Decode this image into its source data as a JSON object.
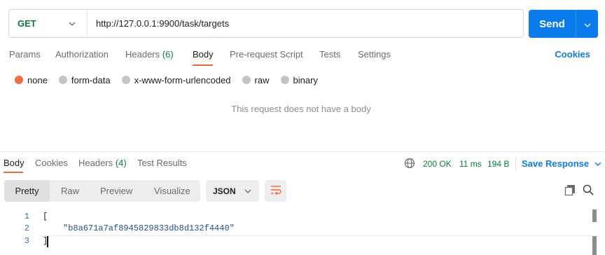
{
  "request": {
    "method": "GET",
    "url": "http://127.0.0.1:9900/task/targets",
    "send_label": "Send"
  },
  "request_tabs": [
    {
      "label": "Params"
    },
    {
      "label": "Authorization"
    },
    {
      "label": "Headers",
      "count": "(6)"
    },
    {
      "label": "Body"
    },
    {
      "label": "Pre-request Script"
    },
    {
      "label": "Tests"
    },
    {
      "label": "Settings"
    }
  ],
  "cookies_link": "Cookies",
  "body_types": {
    "selected": "none",
    "options": [
      "none",
      "form-data",
      "x-www-form-urlencoded",
      "raw",
      "binary"
    ]
  },
  "empty_body_text": "This request does not have a body",
  "response_tabs": [
    {
      "label": "Body"
    },
    {
      "label": "Cookies"
    },
    {
      "label": "Headers",
      "count": "(4)"
    },
    {
      "label": "Test Results"
    }
  ],
  "response_status": {
    "status": "200 OK",
    "time": "11 ms",
    "size": "194 B",
    "save_label": "Save Response"
  },
  "view_modes": [
    "Pretty",
    "Raw",
    "Preview",
    "Visualize"
  ],
  "format": "JSON",
  "code_lines": [
    {
      "num": "1",
      "text": "["
    },
    {
      "num": "2",
      "text": "\"b8a671a7af8945829833db8d132f4440\""
    },
    {
      "num": "3",
      "text": "]"
    }
  ],
  "colors": {
    "accent": "#097bed",
    "active_tab_underline": "#f26b3a",
    "status_green": "#0b7d3e"
  },
  "icons": {
    "method_dropdown": "chevron-down-icon",
    "send_dropdown": "chevron-down-icon",
    "network": "globe-icon",
    "wrap": "wrap-lines-icon",
    "copy": "copy-icon",
    "search": "search-icon"
  }
}
